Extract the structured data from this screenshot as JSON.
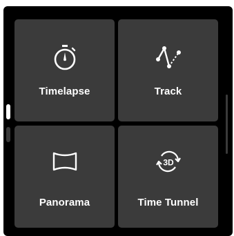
{
  "tiles": [
    {
      "label": "Timelapse",
      "icon": "stopwatch-icon"
    },
    {
      "label": "Track",
      "icon": "track-path-icon"
    },
    {
      "label": "Panorama",
      "icon": "panorama-icon"
    },
    {
      "label": "Time Tunnel",
      "icon": "3d-rotate-icon",
      "icon_text": "3D"
    }
  ],
  "pager": {
    "pages": 2,
    "current": 1
  },
  "colors": {
    "background": "#000000",
    "tile": "#3b3b3b",
    "text": "#ffffff"
  }
}
